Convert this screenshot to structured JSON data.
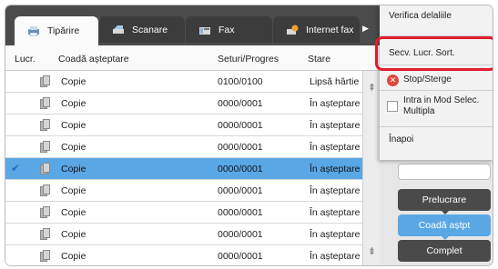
{
  "tabs": [
    {
      "label": "Tipărire",
      "icon": "printer-icon",
      "active": true
    },
    {
      "label": "Scanare",
      "icon": "scanner-icon",
      "active": false
    },
    {
      "label": "Fax",
      "icon": "fax-icon",
      "active": false
    },
    {
      "label": "Internet fax",
      "icon": "internet-fax-icon",
      "active": false
    }
  ],
  "table": {
    "headers": {
      "lucr": "Lucr.",
      "name": "Coadă așteptare",
      "sets": "Seturi/Progres",
      "status": "Stare"
    },
    "rows": [
      {
        "name": "Copie",
        "sets": "0100/0100",
        "status": "Lipsă hârtie",
        "selected": false
      },
      {
        "name": "Copie",
        "sets": "0000/0001",
        "status": "În așteptare",
        "selected": false
      },
      {
        "name": "Copie",
        "sets": "0000/0001",
        "status": "În așteptare",
        "selected": false
      },
      {
        "name": "Copie",
        "sets": "0000/0001",
        "status": "În așteptare",
        "selected": false
      },
      {
        "name": "Copie",
        "sets": "0000/0001",
        "status": "În așteptare",
        "selected": true
      },
      {
        "name": "Copie",
        "sets": "0000/0001",
        "status": "În așteptare",
        "selected": false
      },
      {
        "name": "Copie",
        "sets": "0000/0001",
        "status": "În așteptare",
        "selected": false
      },
      {
        "name": "Copie",
        "sets": "0000/0001",
        "status": "În așteptare",
        "selected": false
      },
      {
        "name": "Copie",
        "sets": "0000/0001",
        "status": "În așteptare",
        "selected": false
      }
    ]
  },
  "menu": {
    "verifica": "Verifica delaliile",
    "secv": "Secv. Lucr. Sort.",
    "stop": "Stop/Sterge",
    "multi": "Intra in Mod Selec. Multipla",
    "inapoi": "Înapoi"
  },
  "panel": {
    "prelucrare": "Prelucrare",
    "coada": "Coadă aștpt",
    "complet": "Complet"
  },
  "colors": {
    "selected_row": "#5aa7e6",
    "highlight": "#e11d2b",
    "tab_bar": "#4b4b4b"
  }
}
